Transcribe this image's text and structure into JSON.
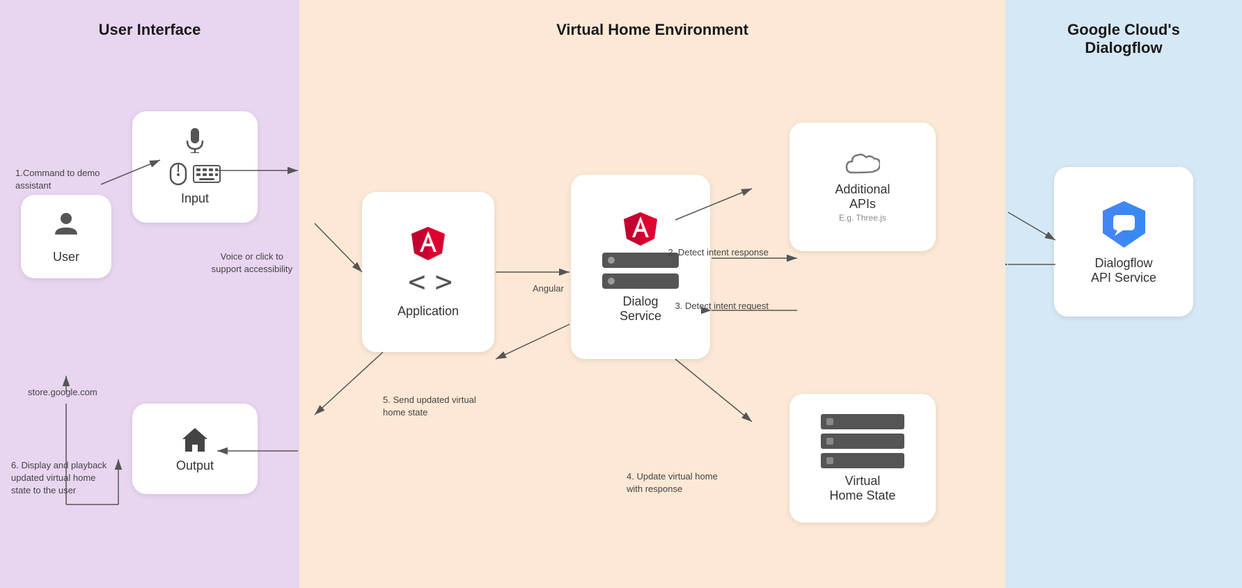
{
  "sections": {
    "ui": {
      "title": "User Interface",
      "bg_color": "#e8d5f0"
    },
    "vhe": {
      "title": "Virtual Home Environment",
      "bg_color": "#fce8d5"
    },
    "gc": {
      "title": "Google Cloud's\nDialogflow",
      "bg_color": "#d5e8f5"
    }
  },
  "cards": {
    "user": {
      "label": "User"
    },
    "input": {
      "label": "Input"
    },
    "output": {
      "label": "Output"
    },
    "application": {
      "label": "Application"
    },
    "dialog_service": {
      "label": "Dialog\nService"
    },
    "additional_apis": {
      "label": "Additional\nAPIs",
      "sublabel": "E.g. Three.js"
    },
    "virtual_home_state": {
      "label": "Virtual\nHome State"
    },
    "dialogflow": {
      "label": "Dialogflow\nAPI Service"
    }
  },
  "labels": {
    "command": "1.Command to demo\nassistant",
    "voice_click": "Voice or click to\nsupport accessibility",
    "angular": "Angular",
    "send_state": "5. Send updated virtual\nhome state",
    "update_virtual": "4. Update virtual home\nwith response",
    "detect_response": "2. Detect intent response",
    "detect_request": "3. Detect intent request",
    "display_playback": "6. Display and playback\nupdated virtual home\nstate to the user",
    "store_google": "store.google.com"
  }
}
